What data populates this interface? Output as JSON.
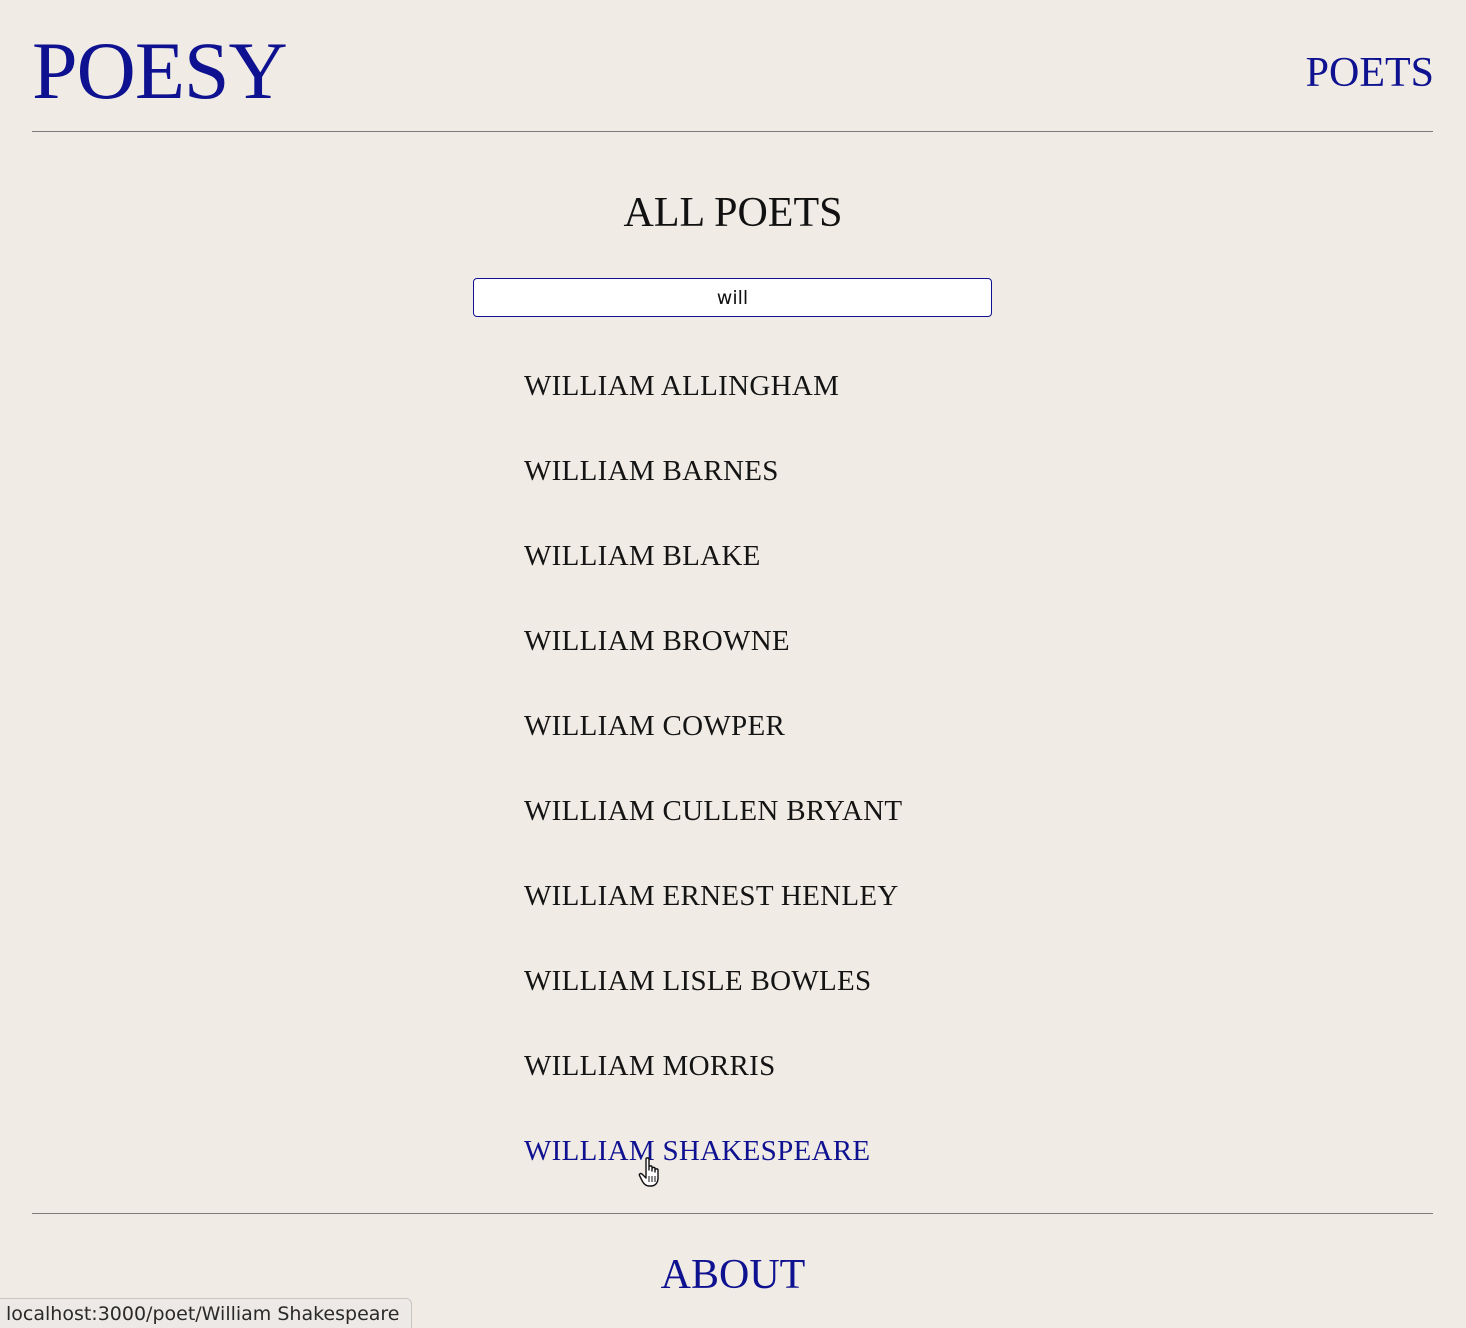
{
  "header": {
    "logo": "POESY",
    "nav_poets": "POETS"
  },
  "main": {
    "title": "ALL POETS",
    "search": {
      "value": "will",
      "placeholder": ""
    },
    "poets": [
      "WILLIAM ALLINGHAM",
      "WILLIAM BARNES",
      "WILLIAM BLAKE",
      "WILLIAM BROWNE",
      "WILLIAM COWPER",
      "WILLIAM CULLEN BRYANT",
      "WILLIAM ERNEST HENLEY",
      "WILLIAM LISLE BOWLES",
      "WILLIAM MORRIS",
      "WILLIAM SHAKESPEARE"
    ],
    "hovered_poet": "WILLIAM SHAKESPEARE"
  },
  "footer": {
    "about": "ABOUT"
  },
  "status_bar": {
    "url": "localhost:3000/poet/William Shakespeare"
  },
  "colors": {
    "background": "#f0ebe5",
    "accent": "#0e1190",
    "text": "#141414",
    "rule": "#7b7b7b"
  },
  "icons": {
    "cursor": "pointer-hand-cursor-icon"
  }
}
